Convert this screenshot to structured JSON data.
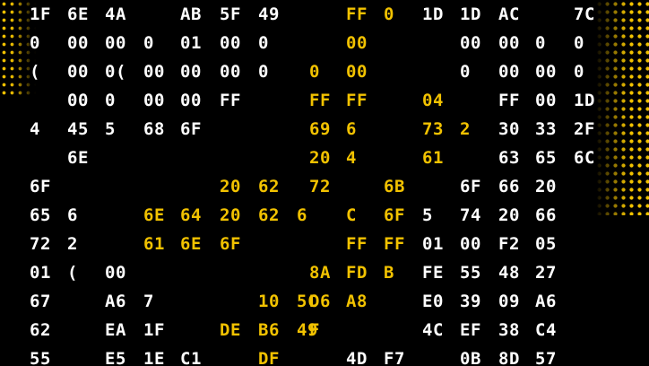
{
  "palette": {
    "background": "#000000",
    "white": "#ffffff",
    "accent": "#f2c200"
  },
  "rows": [
    [
      [
        "1F",
        "w"
      ],
      [
        "6E",
        "w"
      ],
      [
        "4A",
        "w"
      ],
      [
        "",
        "w"
      ],
      [
        "AB",
        "w"
      ],
      [
        "5F",
        "w"
      ],
      [
        "49",
        "w"
      ],
      [
        "",
        "w"
      ],
      [
        "",
        "w"
      ],
      [
        "FF",
        "y"
      ],
      [
        "0",
        "y"
      ],
      [
        "1D",
        "w"
      ],
      [
        "1D",
        "w"
      ],
      [
        "AC",
        "w"
      ],
      [
        "",
        "w"
      ],
      [
        "7C",
        "w"
      ]
    ],
    [
      [
        "0",
        "w"
      ],
      [
        "00",
        "w"
      ],
      [
        "00",
        "w"
      ],
      [
        "0",
        "w"
      ],
      [
        "01",
        "w"
      ],
      [
        "00",
        "w"
      ],
      [
        "0",
        "w"
      ],
      [
        "",
        "w"
      ],
      [
        "",
        "w"
      ],
      [
        "00",
        "y"
      ],
      [
        "",
        "w"
      ],
      [
        "",
        "w"
      ],
      [
        "00",
        "w"
      ],
      [
        "00",
        "w"
      ],
      [
        "0",
        "w"
      ],
      [
        "0",
        "w"
      ]
    ],
    [
      [
        "(",
        "w"
      ],
      [
        "00",
        "w"
      ],
      [
        "0(",
        "w"
      ],
      [
        "00",
        "w"
      ],
      [
        "00",
        "w"
      ],
      [
        "00",
        "w"
      ],
      [
        "0",
        "w"
      ],
      [
        "",
        "w"
      ],
      [
        "0",
        "y"
      ],
      [
        "00",
        "y"
      ],
      [
        "",
        "w"
      ],
      [
        "",
        "w"
      ],
      [
        "0",
        "w"
      ],
      [
        "00",
        "w"
      ],
      [
        "00",
        "w"
      ],
      [
        "0",
        "w"
      ]
    ],
    [
      [
        "",
        "w"
      ],
      [
        "00",
        "w"
      ],
      [
        "0",
        "w"
      ],
      [
        "00",
        "w"
      ],
      [
        "00",
        "w"
      ],
      [
        "FF",
        "w"
      ],
      [
        "",
        "w"
      ],
      [
        "",
        "w"
      ],
      [
        "FF",
        "y"
      ],
      [
        "FF",
        "y"
      ],
      [
        "",
        "w"
      ],
      [
        "04",
        "y"
      ],
      [
        "",
        "w"
      ],
      [
        "FF",
        "w"
      ],
      [
        "00",
        "w"
      ],
      [
        "1D",
        "w"
      ]
    ],
    [
      [
        "4",
        "w"
      ],
      [
        "45",
        "w"
      ],
      [
        "5",
        "w"
      ],
      [
        "68",
        "w"
      ],
      [
        "6F",
        "w"
      ],
      [
        "",
        "w"
      ],
      [
        "",
        "w"
      ],
      [
        "",
        "w"
      ],
      [
        "69",
        "y"
      ],
      [
        "6",
        "y"
      ],
      [
        "",
        "w"
      ],
      [
        "73",
        "y"
      ],
      [
        "2",
        "y"
      ],
      [
        "30",
        "w"
      ],
      [
        "33",
        "w"
      ],
      [
        "2F",
        "w"
      ]
    ],
    [
      [
        "",
        "w"
      ],
      [
        "6E",
        "w"
      ],
      [
        "",
        "w"
      ],
      [
        "",
        "w"
      ],
      [
        "",
        "w"
      ],
      [
        "",
        "w"
      ],
      [
        "",
        "w"
      ],
      [
        "",
        "w"
      ],
      [
        "20",
        "y"
      ],
      [
        "4",
        "y"
      ],
      [
        "",
        "w"
      ],
      [
        "61",
        "y"
      ],
      [
        "",
        "w"
      ],
      [
        "63",
        "w"
      ],
      [
        "65",
        "w"
      ],
      [
        "6C",
        "w"
      ]
    ],
    [
      [
        "6F",
        "w"
      ],
      [
        "",
        "w"
      ],
      [
        "",
        "w"
      ],
      [
        "",
        "w"
      ],
      [
        "",
        "w"
      ],
      [
        "20",
        "y"
      ],
      [
        "62",
        "y"
      ],
      [
        "",
        "w"
      ],
      [
        "72",
        "y"
      ],
      [
        "",
        "w"
      ],
      [
        "6B",
        "y"
      ],
      [
        "",
        "w"
      ],
      [
        "6F",
        "w"
      ],
      [
        "66",
        "w"
      ],
      [
        "20",
        "w"
      ],
      [
        "",
        "w"
      ]
    ],
    [
      [
        "65",
        "w"
      ],
      [
        "6",
        "w"
      ],
      [
        "",
        "w"
      ],
      [
        "6E",
        "y"
      ],
      [
        "64",
        "y"
      ],
      [
        "20",
        "y"
      ],
      [
        "62",
        "y"
      ],
      [
        "6",
        "y"
      ],
      [
        "",
        "w"
      ],
      [
        "C",
        "y"
      ],
      [
        "6F",
        "y"
      ],
      [
        "5",
        "w"
      ],
      [
        "74",
        "w"
      ],
      [
        "20",
        "w"
      ],
      [
        "66",
        "w"
      ],
      [
        "",
        "w"
      ]
    ],
    [
      [
        "72",
        "w"
      ],
      [
        "2",
        "w"
      ],
      [
        "",
        "w"
      ],
      [
        "61",
        "y"
      ],
      [
        "6E",
        "y"
      ],
      [
        "6F",
        "y"
      ],
      [
        "",
        "w"
      ],
      [
        "",
        "w"
      ],
      [
        "",
        "w"
      ],
      [
        "FF",
        "y"
      ],
      [
        "FF",
        "y"
      ],
      [
        "01",
        "w"
      ],
      [
        "00",
        "w"
      ],
      [
        "F2",
        "w"
      ],
      [
        "05",
        "w"
      ],
      [
        "",
        "w"
      ]
    ],
    [
      [
        "01",
        "w"
      ],
      [
        "(",
        "w"
      ],
      [
        "00",
        "w"
      ],
      [
        "",
        "w"
      ],
      [
        "",
        "w"
      ],
      [
        "",
        "w"
      ],
      [
        "",
        "w"
      ],
      [
        "",
        "w"
      ],
      [
        "8A",
        "y"
      ],
      [
        "FD",
        "y"
      ],
      [
        "B",
        "y"
      ],
      [
        "FE",
        "w"
      ],
      [
        "55",
        "w"
      ],
      [
        "48",
        "w"
      ],
      [
        "27",
        "w"
      ],
      [
        "",
        "w"
      ]
    ],
    [
      [
        "67",
        "w"
      ],
      [
        "",
        "w"
      ],
      [
        "A6",
        "w"
      ],
      [
        "7",
        "w"
      ],
      [
        "",
        "w"
      ],
      [
        "",
        "w"
      ],
      [
        "10",
        "y"
      ],
      [
        "5C",
        "y"
      ],
      [
        "D6",
        "y"
      ],
      [
        "A8",
        "y"
      ],
      [
        "",
        "w"
      ],
      [
        "E0",
        "w"
      ],
      [
        "39",
        "w"
      ],
      [
        "09",
        "w"
      ],
      [
        "A6",
        "w"
      ],
      [
        "",
        "w"
      ]
    ],
    [
      [
        "62",
        "w"
      ],
      [
        "",
        "w"
      ],
      [
        "EA",
        "w"
      ],
      [
        "1F",
        "w"
      ],
      [
        "",
        "w"
      ],
      [
        "DE",
        "y"
      ],
      [
        "B6",
        "y"
      ],
      [
        "49",
        "y"
      ],
      [
        "F",
        "y"
      ],
      [
        "",
        "w"
      ],
      [
        "",
        "w"
      ],
      [
        "4C",
        "w"
      ],
      [
        "EF",
        "w"
      ],
      [
        "38",
        "w"
      ],
      [
        "C4",
        "w"
      ],
      [
        "",
        "w"
      ]
    ],
    [
      [
        "55",
        "w"
      ],
      [
        "",
        "w"
      ],
      [
        "E5",
        "w"
      ],
      [
        "1E",
        "w"
      ],
      [
        "C1",
        "w"
      ],
      [
        "",
        "w"
      ],
      [
        "DF",
        "y"
      ],
      [
        "",
        "w"
      ],
      [
        "",
        "w"
      ],
      [
        "4D",
        "w"
      ],
      [
        "F7",
        "w"
      ],
      [
        "",
        "w"
      ],
      [
        "0B",
        "w"
      ],
      [
        "8D",
        "w"
      ],
      [
        "57",
        "w"
      ],
      [
        "",
        "w"
      ]
    ]
  ]
}
